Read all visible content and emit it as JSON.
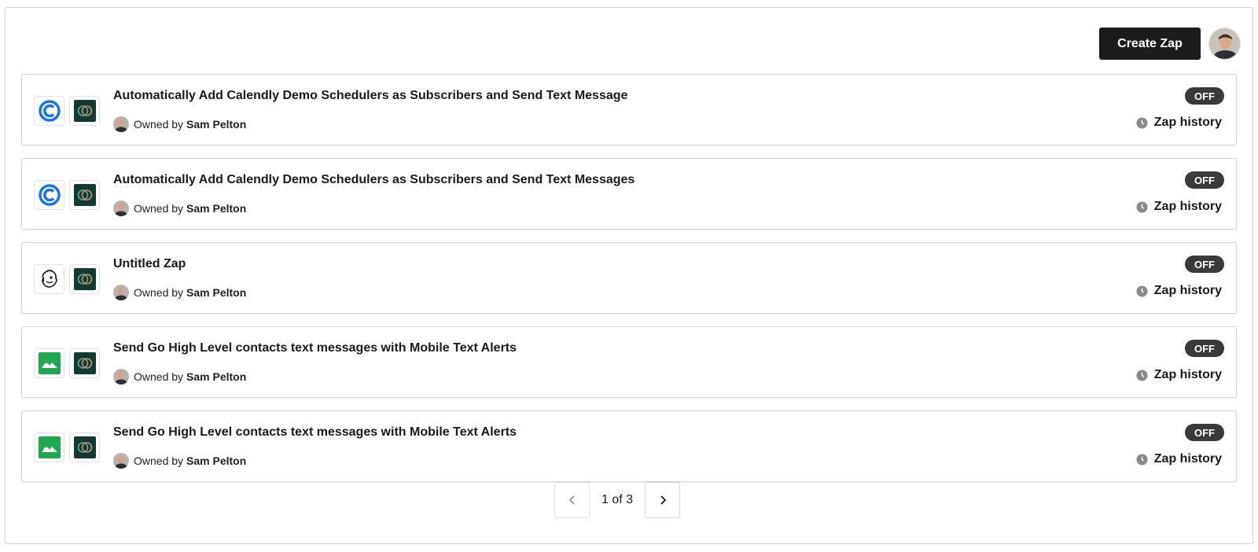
{
  "header": {
    "create_label": "Create Zap"
  },
  "zaps": [
    {
      "title": "Automatically Add Calendly Demo Schedulers as Subscribers and Send Text Message",
      "owner_prefix": "Owned by",
      "owner": "Sam Pelton",
      "status": "OFF",
      "history_label": "Zap history",
      "trigger_icon": "calendly-icon",
      "action_icon": "mobile-text-alerts-icon"
    },
    {
      "title": "Automatically Add Calendly Demo Schedulers as Subscribers and Send Text Messages",
      "owner_prefix": "Owned by",
      "owner": "Sam Pelton",
      "status": "OFF",
      "history_label": "Zap history",
      "trigger_icon": "calendly-icon",
      "action_icon": "mobile-text-alerts-icon"
    },
    {
      "title": "Untitled Zap",
      "owner_prefix": "Owned by",
      "owner": "Sam Pelton",
      "status": "OFF",
      "history_label": "Zap history",
      "trigger_icon": "mailchimp-icon",
      "action_icon": "mobile-text-alerts-icon"
    },
    {
      "title": "Send Go High Level contacts text messages with Mobile Text Alerts",
      "owner_prefix": "Owned by",
      "owner": "Sam Pelton",
      "status": "OFF",
      "history_label": "Zap history",
      "trigger_icon": "gohighlevel-icon",
      "action_icon": "mobile-text-alerts-icon"
    },
    {
      "title": "Send Go High Level contacts text messages with Mobile Text Alerts",
      "owner_prefix": "Owned by",
      "owner": "Sam Pelton",
      "status": "OFF",
      "history_label": "Zap history",
      "trigger_icon": "gohighlevel-icon",
      "action_icon": "mobile-text-alerts-icon"
    }
  ],
  "pagination": {
    "label": "1 of 3"
  },
  "colors": {
    "primary_button": "#1c1c1c",
    "toggle_off": "#3a3a3a",
    "calendly": "#1a73e8",
    "gohighlevel": "#1fa84f",
    "mobile_text_alerts": "#123a33"
  }
}
